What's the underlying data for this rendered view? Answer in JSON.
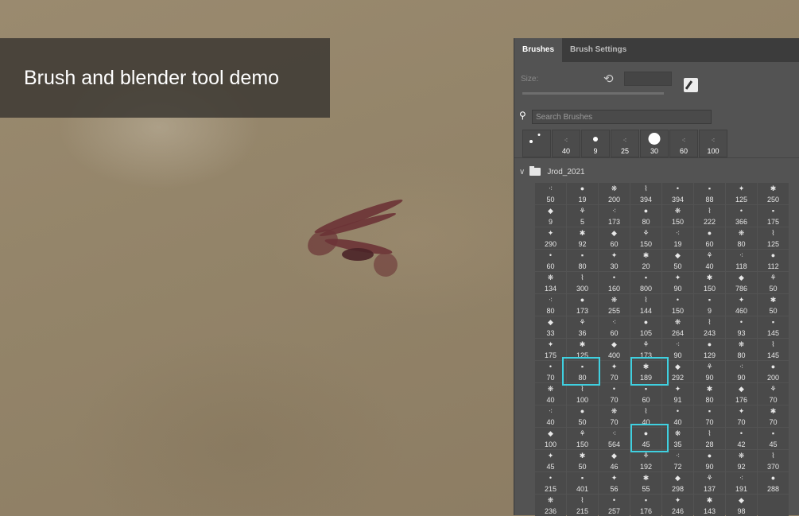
{
  "banner": {
    "title": "Brush and blender tool demo"
  },
  "panel": {
    "tabs": [
      "Brushes",
      "Brush Settings"
    ],
    "size_label": "Size:",
    "search_placeholder": "Search Brushes",
    "recent_brushes": [
      "",
      "40",
      "9",
      "25",
      "30",
      "60",
      "100"
    ],
    "folder_name": "Jrod_2021",
    "brush_sizes": [
      "50",
      "19",
      "200",
      "394",
      "394",
      "88",
      "125",
      "250",
      "9",
      "5",
      "173",
      "80",
      "150",
      "222",
      "366",
      "175",
      "290",
      "92",
      "60",
      "150",
      "19",
      "60",
      "80",
      "125",
      "60",
      "80",
      "30",
      "20",
      "50",
      "40",
      "118",
      "112",
      "134",
      "300",
      "160",
      "800",
      "90",
      "150",
      "786",
      "50",
      "80",
      "173",
      "255",
      "144",
      "150",
      "9",
      "460",
      "50",
      "33",
      "36",
      "60",
      "105",
      "264",
      "243",
      "93",
      "145",
      "175",
      "125",
      "400",
      "173",
      "90",
      "129",
      "80",
      "145",
      "70",
      "80",
      "70",
      "189",
      "292",
      "90",
      "90",
      "200",
      "40",
      "100",
      "70",
      "60",
      "91",
      "80",
      "176",
      "70",
      "40",
      "50",
      "70",
      "40",
      "40",
      "70",
      "70",
      "70",
      "100",
      "150",
      "564",
      "45",
      "35",
      "28",
      "42",
      "45",
      "45",
      "50",
      "46",
      "192",
      "72",
      "90",
      "92",
      "370",
      "215",
      "401",
      "56",
      "55",
      "298",
      "137",
      "191",
      "288",
      "236",
      "215",
      "257",
      "176",
      "246",
      "143",
      "98",
      ""
    ],
    "highlighted_brushes": [
      "80",
      "189",
      "45"
    ],
    "accent_color": "#3fd0e0"
  }
}
